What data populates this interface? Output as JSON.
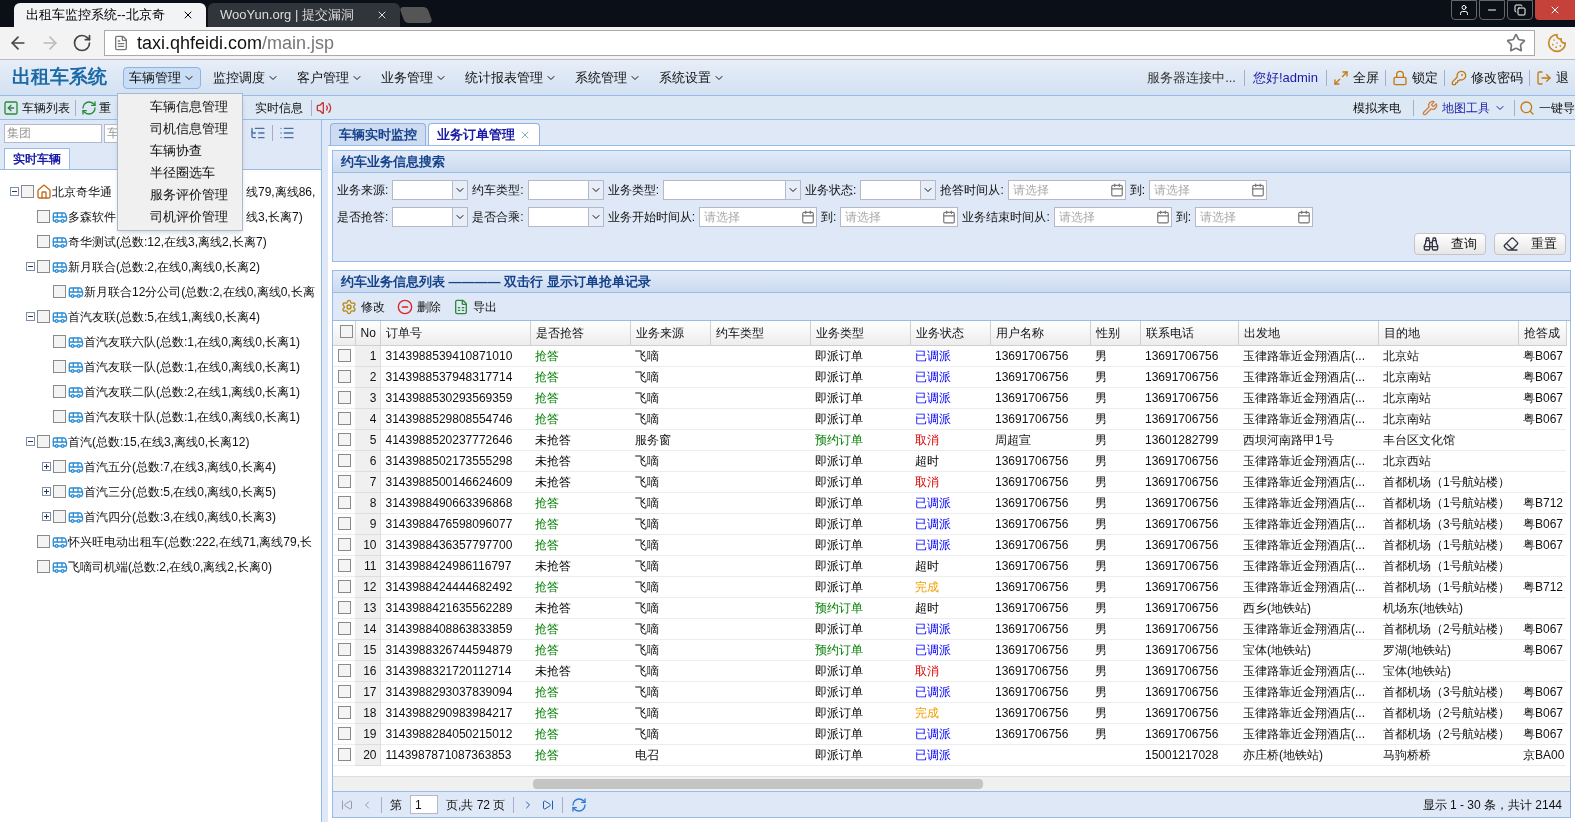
{
  "browser": {
    "tabs": [
      {
        "title": "出租车监控系统--北京奇",
        "selected": true
      },
      {
        "title": "WooYun.org | 提交漏洞",
        "selected": false
      }
    ],
    "url_host": "taxi.qhfeidi.com",
    "url_path": "/main.jsp"
  },
  "header": {
    "logo": "出租车系统",
    "nav": [
      {
        "label": "车辆管理",
        "selected": true
      },
      {
        "label": "监控调度",
        "selected": false
      },
      {
        "label": "客户管理",
        "selected": false
      },
      {
        "label": "业务管理",
        "selected": false
      },
      {
        "label": "统计报表管理",
        "selected": false
      },
      {
        "label": "系统管理",
        "selected": false
      },
      {
        "label": "系统设置",
        "selected": false
      }
    ],
    "open_menu": [
      "车辆信息管理",
      "司机信息管理",
      "车辆协查",
      "半径圈选车",
      "服务评价管理",
      "司机评价管理"
    ],
    "server_status": "服务器连接中...",
    "greeting": "您好!admin",
    "actions": [
      "全屏",
      "锁定",
      "修改密码",
      "退"
    ]
  },
  "toolbar": {
    "left": [
      "车辆列表",
      "重",
      "实时信息"
    ],
    "simulate": "模拟来电",
    "map_tools": "地图工具",
    "one_key": "一键导"
  },
  "left_panel": {
    "group_placeholder": "集团",
    "second_placeholder": "车",
    "tab": "实时车辆",
    "tree": [
      {
        "kind": "company",
        "parts": [
          "北京奇华通",
          "线79,离线86,"
        ],
        "checked": false,
        "expanded": true,
        "children": [
          {
            "kind": "fleet",
            "parts": [
              "多森软件",
              "线3,长离7)"
            ],
            "checked": false
          },
          {
            "kind": "fleet",
            "parts": [
              "奇华测试(总数:12,在线3,离线2,长离7)"
            ],
            "checked": false
          },
          {
            "kind": "fleet",
            "parts": [
              "新月联合(总数:2,在线0,离线0,长离2)"
            ],
            "checked": false,
            "expanded": true,
            "children": [
              {
                "kind": "fleet",
                "parts": [
                  "新月联合12分公司(总数:2,在线0,离线0,长离"
                ],
                "checked": false
              }
            ]
          },
          {
            "kind": "fleet",
            "parts": [
              "首汽友联(总数:5,在线1,离线0,长离4)"
            ],
            "checked": false,
            "expanded": true,
            "children": [
              {
                "kind": "fleet",
                "parts": [
                  "首汽友联六队(总数:1,在线0,离线0,长离1)"
                ],
                "checked": false
              },
              {
                "kind": "fleet",
                "parts": [
                  "首汽友联一队(总数:1,在线0,离线0,长离1)"
                ],
                "checked": false
              },
              {
                "kind": "fleet",
                "parts": [
                  "首汽友联二队(总数:2,在线1,离线0,长离1)"
                ],
                "checked": false
              },
              {
                "kind": "fleet",
                "parts": [
                  "首汽友联十队(总数:1,在线0,离线0,长离1)"
                ],
                "checked": false
              }
            ]
          },
          {
            "kind": "fleet",
            "parts": [
              "首汽(总数:15,在线3,离线0,长离12)"
            ],
            "checked": false,
            "expanded": true,
            "children": [
              {
                "kind": "fleet",
                "parts": [
                  "首汽五分(总数:7,在线3,离线0,长离4)"
                ],
                "checked": false,
                "expanded": false
              },
              {
                "kind": "fleet",
                "parts": [
                  "首汽三分(总数:5,在线0,离线0,长离5)"
                ],
                "checked": false,
                "expanded": false
              },
              {
                "kind": "fleet",
                "parts": [
                  "首汽四分(总数:3,在线0,离线0,长离3)"
                ],
                "checked": false,
                "expanded": false
              }
            ]
          },
          {
            "kind": "fleet",
            "parts": [
              "怀兴旺电动出租车(总数:222,在线71,离线79,长"
            ],
            "checked": false
          },
          {
            "kind": "fleet",
            "parts": [
              "飞嘀司机端(总数:2,在线0,离线2,长离0)"
            ],
            "checked": false
          }
        ]
      }
    ]
  },
  "main_tabs": [
    {
      "label": "车辆实时监控",
      "selected": false
    },
    {
      "label": "业务订单管理",
      "selected": true,
      "closable": true
    }
  ],
  "search": {
    "title": "约车业务信息搜索",
    "rows": [
      [
        {
          "kind": "select",
          "label": "业务来源:"
        },
        {
          "kind": "select",
          "label": "约车类型:"
        },
        {
          "kind": "select",
          "label": "业务类型:",
          "wide": true
        },
        {
          "kind": "select",
          "label": "业务状态:"
        },
        {
          "kind": "date",
          "label": "抢答时间从:",
          "placeholder": "请选择"
        },
        {
          "kind": "date",
          "label": "到:",
          "placeholder": "请选择"
        }
      ],
      [
        {
          "kind": "select",
          "label": "是否抢答:"
        },
        {
          "kind": "select",
          "label": "是否合乘:"
        },
        {
          "kind": "date",
          "label": "业务开始时间从:",
          "placeholder": "请选择"
        },
        {
          "kind": "date",
          "label": "到:",
          "placeholder": "请选择"
        },
        {
          "kind": "date",
          "label": "业务结束时间从:",
          "placeholder": "请选择"
        },
        {
          "kind": "date",
          "label": "到:",
          "placeholder": "请选择"
        }
      ]
    ],
    "buttons": [
      "查询",
      "重置"
    ]
  },
  "list": {
    "title": "约车业务信息列表 ———— 双击行 显示订单抢单记录",
    "actions": [
      "修改",
      "删除",
      "导出"
    ],
    "header_checked": false,
    "columns": [
      "No",
      "订单号",
      "是否抢答",
      "业务来源",
      "约车类型",
      "业务类型",
      "业务状态",
      "用户名称",
      "性别",
      "联系电话",
      "出发地",
      "目的地",
      "抢答成"
    ],
    "rows": [
      {
        "checked": false,
        "no": "1",
        "order": "3143988539410871010",
        "grab": {
          "text": "抢答",
          "answered": true
        },
        "source": "飞嘀",
        "type": {
          "text": "即派订单",
          "kind": "instant"
        },
        "status": {
          "text": "已调派",
          "kind": "dispatched"
        },
        "user": "13691706756",
        "gender": "男",
        "phone": "13691706756",
        "origin": "玉律路靠近金翔酒店(...",
        "dest": "北京站",
        "plate": "粤B067"
      },
      {
        "checked": false,
        "no": "2",
        "order": "3143988537948317714",
        "grab": {
          "text": "抢答",
          "answered": true
        },
        "source": "飞嘀",
        "type": {
          "text": "即派订单",
          "kind": "instant"
        },
        "status": {
          "text": "已调派",
          "kind": "dispatched"
        },
        "user": "13691706756",
        "gender": "男",
        "phone": "13691706756",
        "origin": "玉律路靠近金翔酒店(...",
        "dest": "北京南站",
        "plate": "粤B067"
      },
      {
        "checked": false,
        "no": "3",
        "order": "3143988530293569359",
        "grab": {
          "text": "抢答",
          "answered": true
        },
        "source": "飞嘀",
        "type": {
          "text": "即派订单",
          "kind": "instant"
        },
        "status": {
          "text": "已调派",
          "kind": "dispatched"
        },
        "user": "13691706756",
        "gender": "男",
        "phone": "13691706756",
        "origin": "玉律路靠近金翔酒店(...",
        "dest": "北京南站",
        "plate": "粤B067"
      },
      {
        "checked": false,
        "no": "4",
        "order": "3143988529808554746",
        "grab": {
          "text": "抢答",
          "answered": true
        },
        "source": "飞嘀",
        "type": {
          "text": "即派订单",
          "kind": "instant"
        },
        "status": {
          "text": "已调派",
          "kind": "dispatched"
        },
        "user": "13691706756",
        "gender": "男",
        "phone": "13691706756",
        "origin": "玉律路靠近金翔酒店(...",
        "dest": "北京南站",
        "plate": "粤B067"
      },
      {
        "checked": false,
        "no": "5",
        "order": "4143988520237772646",
        "grab": {
          "text": "未抢答",
          "answered": false
        },
        "source": "服务窗",
        "type": {
          "text": "预约订单",
          "kind": "reserved"
        },
        "status": {
          "text": "取消",
          "kind": "cancelled"
        },
        "user": "周超宣",
        "gender": "男",
        "phone": "13601282799",
        "origin": "西坝河南路甲1号",
        "dest": "丰台区文化馆"
      },
      {
        "checked": false,
        "no": "6",
        "order": "3143988502173555298",
        "grab": {
          "text": "未抢答",
          "answered": false
        },
        "source": "飞嘀",
        "type": {
          "text": "即派订单",
          "kind": "instant"
        },
        "status": {
          "text": "超时",
          "kind": "timeout"
        },
        "user": "13691706756",
        "gender": "男",
        "phone": "13691706756",
        "origin": "玉律路靠近金翔酒店(...",
        "dest": "北京西站"
      },
      {
        "checked": false,
        "no": "7",
        "order": "3143988500146624609",
        "grab": {
          "text": "未抢答",
          "answered": false
        },
        "source": "飞嘀",
        "type": {
          "text": "即派订单",
          "kind": "instant"
        },
        "status": {
          "text": "取消",
          "kind": "cancelled"
        },
        "user": "13691706756",
        "gender": "男",
        "phone": "13691706756",
        "origin": "玉律路靠近金翔酒店(...",
        "dest": "首都机场（1号航站楼）"
      },
      {
        "checked": false,
        "no": "8",
        "order": "3143988490663396868",
        "grab": {
          "text": "抢答",
          "answered": true
        },
        "source": "飞嘀",
        "type": {
          "text": "即派订单",
          "kind": "instant"
        },
        "status": {
          "text": "已调派",
          "kind": "dispatched"
        },
        "user": "13691706756",
        "gender": "男",
        "phone": "13691706756",
        "origin": "玉律路靠近金翔酒店(...",
        "dest": "首都机场（1号航站楼）",
        "plate": "粤B712"
      },
      {
        "checked": false,
        "no": "9",
        "order": "3143988476598096077",
        "grab": {
          "text": "抢答",
          "answered": true
        },
        "source": "飞嘀",
        "type": {
          "text": "即派订单",
          "kind": "instant"
        },
        "status": {
          "text": "已调派",
          "kind": "dispatched"
        },
        "user": "13691706756",
        "gender": "男",
        "phone": "13691706756",
        "origin": "玉律路靠近金翔酒店(...",
        "dest": "首都机场（3号航站楼）",
        "plate": "粤B067"
      },
      {
        "checked": false,
        "no": "10",
        "order": "3143988436357797700",
        "grab": {
          "text": "抢答",
          "answered": true
        },
        "source": "飞嘀",
        "type": {
          "text": "即派订单",
          "kind": "instant"
        },
        "status": {
          "text": "已调派",
          "kind": "dispatched"
        },
        "user": "13691706756",
        "gender": "男",
        "phone": "13691706756",
        "origin": "玉律路靠近金翔酒店(...",
        "dest": "首都机场（1号航站楼）",
        "plate": "粤B067"
      },
      {
        "checked": false,
        "no": "11",
        "order": "3143988424986116797",
        "grab": {
          "text": "未抢答",
          "answered": false
        },
        "source": "飞嘀",
        "type": {
          "text": "即派订单",
          "kind": "instant"
        },
        "status": {
          "text": "超时",
          "kind": "timeout"
        },
        "user": "13691706756",
        "gender": "男",
        "phone": "13691706756",
        "origin": "玉律路靠近金翔酒店(...",
        "dest": "首都机场（1号航站楼）"
      },
      {
        "checked": false,
        "no": "12",
        "order": "3143988424444682492",
        "grab": {
          "text": "抢答",
          "answered": true
        },
        "source": "飞嘀",
        "type": {
          "text": "即派订单",
          "kind": "instant"
        },
        "status": {
          "text": "完成",
          "kind": "done"
        },
        "user": "13691706756",
        "gender": "男",
        "phone": "13691706756",
        "origin": "玉律路靠近金翔酒店(...",
        "dest": "首都机场（1号航站楼）",
        "plate": "粤B712"
      },
      {
        "checked": false,
        "no": "13",
        "order": "3143988421635562289",
        "grab": {
          "text": "未抢答",
          "answered": false
        },
        "source": "飞嘀",
        "type": {
          "text": "预约订单",
          "kind": "reserved"
        },
        "status": {
          "text": "超时",
          "kind": "timeout"
        },
        "user": "13691706756",
        "gender": "男",
        "phone": "13691706756",
        "origin": "西乡(地铁站)",
        "dest": "机场东(地铁站)"
      },
      {
        "checked": false,
        "no": "14",
        "order": "3143988408863833859",
        "grab": {
          "text": "抢答",
          "answered": true
        },
        "source": "飞嘀",
        "type": {
          "text": "即派订单",
          "kind": "instant"
        },
        "status": {
          "text": "已调派",
          "kind": "dispatched"
        },
        "user": "13691706756",
        "gender": "男",
        "phone": "13691706756",
        "origin": "玉律路靠近金翔酒店(...",
        "dest": "首都机场（2号航站楼）",
        "plate": "粤B067"
      },
      {
        "checked": false,
        "no": "15",
        "order": "3143988326744594879",
        "grab": {
          "text": "抢答",
          "answered": true
        },
        "source": "飞嘀",
        "type": {
          "text": "预约订单",
          "kind": "reserved"
        },
        "status": {
          "text": "已调派",
          "kind": "dispatched"
        },
        "user": "13691706756",
        "gender": "男",
        "phone": "13691706756",
        "origin": "宝体(地铁站)",
        "dest": "罗湖(地铁站)",
        "plate": "粤B067"
      },
      {
        "checked": false,
        "no": "16",
        "order": "3143988321720112714",
        "grab": {
          "text": "未抢答",
          "answered": false
        },
        "source": "飞嘀",
        "type": {
          "text": "即派订单",
          "kind": "instant"
        },
        "status": {
          "text": "取消",
          "kind": "cancelled"
        },
        "user": "13691706756",
        "gender": "男",
        "phone": "13691706756",
        "origin": "玉律路靠近金翔酒店(...",
        "dest": "宝体(地铁站)"
      },
      {
        "checked": false,
        "no": "17",
        "order": "3143988293037839094",
        "grab": {
          "text": "抢答",
          "answered": true
        },
        "source": "飞嘀",
        "type": {
          "text": "即派订单",
          "kind": "instant"
        },
        "status": {
          "text": "已调派",
          "kind": "dispatched"
        },
        "user": "13691706756",
        "gender": "男",
        "phone": "13691706756",
        "origin": "玉律路靠近金翔酒店(...",
        "dest": "首都机场（3号航站楼）",
        "plate": "粤B067"
      },
      {
        "checked": false,
        "no": "18",
        "order": "3143988290983984217",
        "grab": {
          "text": "抢答",
          "answered": true
        },
        "source": "飞嘀",
        "type": {
          "text": "即派订单",
          "kind": "instant"
        },
        "status": {
          "text": "完成",
          "kind": "done"
        },
        "user": "13691706756",
        "gender": "男",
        "phone": "13691706756",
        "origin": "玉律路靠近金翔酒店(...",
        "dest": "首都机场（2号航站楼）",
        "plate": "粤B067"
      },
      {
        "checked": false,
        "no": "19",
        "order": "3143988284050215012",
        "grab": {
          "text": "抢答",
          "answered": true
        },
        "source": "飞嘀",
        "type": {
          "text": "即派订单",
          "kind": "instant"
        },
        "status": {
          "text": "已调派",
          "kind": "dispatched"
        },
        "user": "13691706756",
        "gender": "男",
        "phone": "13691706756",
        "origin": "玉律路靠近金翔酒店(...",
        "dest": "首都机场（2号航站楼）",
        "plate": "粤B067"
      },
      {
        "checked": false,
        "no": "20",
        "order": "1143987871087363853",
        "grab": {
          "text": "抢答",
          "answered": true
        },
        "source": "电召",
        "type": {
          "text": "即派订单",
          "kind": "instant"
        },
        "status": {
          "text": "已调派",
          "kind": "dispatched"
        },
        "phone": "15001217028",
        "origin": "亦庄桥(地铁站)",
        "dest": "马驹桥桥",
        "plate": "京BA00"
      }
    ],
    "pager": {
      "page_prefix": "第",
      "page": "1",
      "page_suffix": "页,共 72 页",
      "summary": "显示 1 - 30 条，共计 2144"
    }
  }
}
